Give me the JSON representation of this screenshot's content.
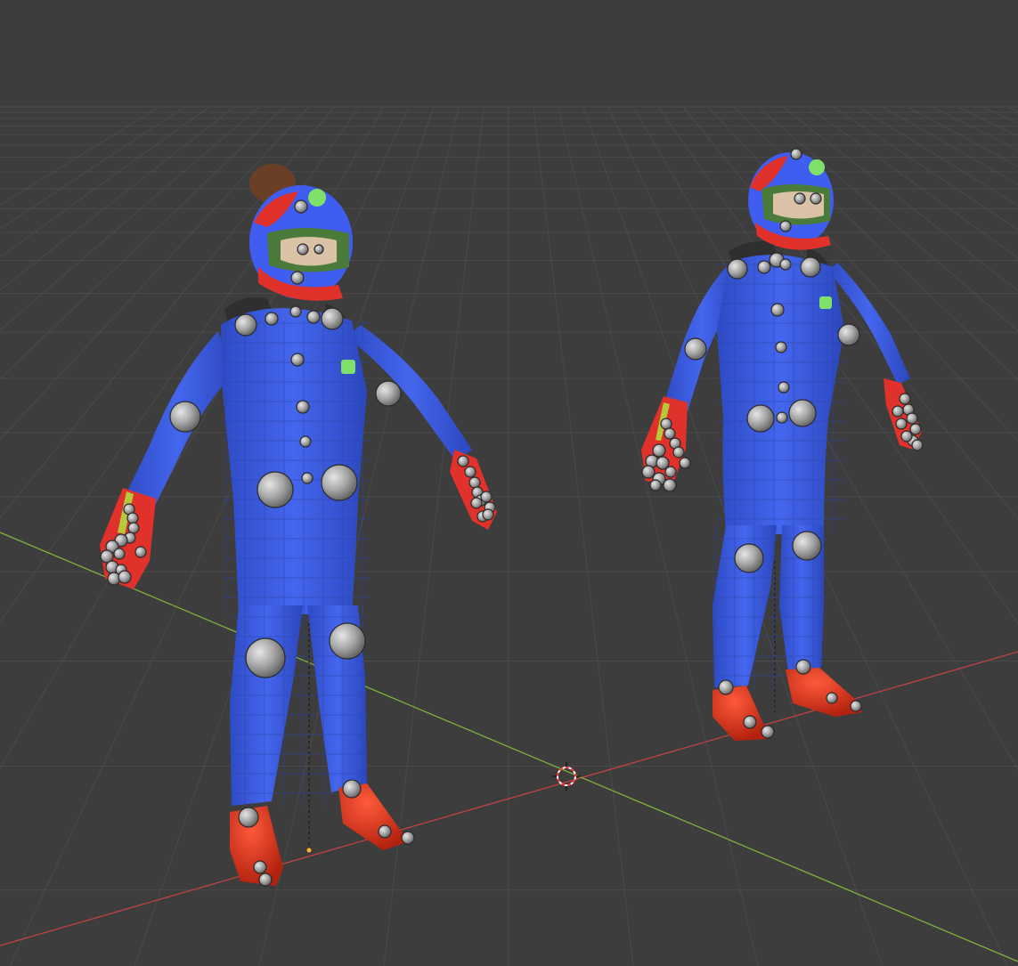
{
  "viewport": {
    "background": "#3d3d3d",
    "grid_color": "#555555",
    "x_axis_color": "#c24343",
    "y_axis_color": "#7fb23a",
    "shading": "solid"
  },
  "cursor_3d": {
    "icon": "3d-cursor-icon",
    "colors": [
      "#ff3b3b",
      "#ffffff"
    ]
  },
  "characters": [
    {
      "id": "racer-left",
      "suit_color": "#3a5bdc",
      "helmet_color": "#3f5df0",
      "accent_color": "#e0322a",
      "logo_color": "#7fe06a",
      "has_hair_bun": true,
      "rig_control_color": "#a8a8a8"
    },
    {
      "id": "racer-right",
      "suit_color": "#3a5bdc",
      "helmet_color": "#3f5df0",
      "accent_color": "#e0322a",
      "logo_color": "#7fe06a",
      "has_hair_bun": false,
      "rig_control_color": "#a8a8a8"
    }
  ]
}
